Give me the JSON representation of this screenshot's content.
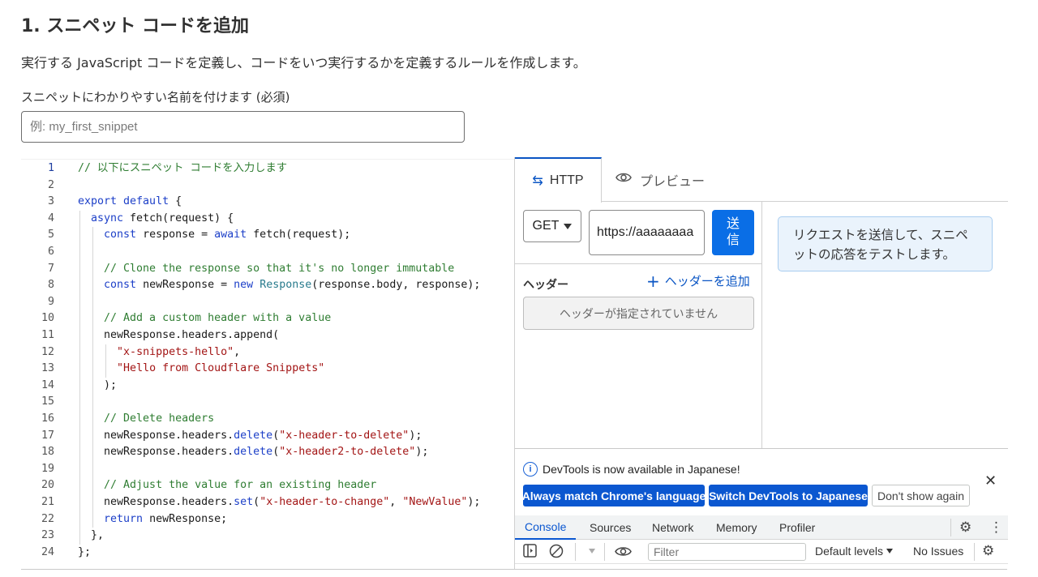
{
  "page": {
    "title": "1. スニペット コードを追加",
    "description": "実行する JavaScript コードを定義し、コードをいつ実行するかを定義するルールを作成します。",
    "name_label": "スニペットにわかりやすい名前を付けます (必須)",
    "name_placeholder": "例: my_first_snippet"
  },
  "editor": {
    "line_numbers": [
      "1",
      "2",
      "3",
      "4",
      "5",
      "6",
      "7",
      "8",
      "9",
      "10",
      "11",
      "12",
      "13",
      "14",
      "15",
      "16",
      "17",
      "18",
      "19",
      "20",
      "21",
      "22",
      "23",
      "24"
    ],
    "active_line": 1,
    "lines": [
      [
        {
          "t": "// 以下にスニペット コードを入力します",
          "c": "cm"
        }
      ],
      [],
      [
        {
          "t": "export default",
          "c": "kw"
        },
        {
          "t": " {",
          "c": ""
        }
      ],
      [
        {
          "t": "  ",
          "c": ""
        },
        {
          "t": "async",
          "c": "kw"
        },
        {
          "t": " fetch(request) {",
          "c": ""
        }
      ],
      [
        {
          "t": "    ",
          "c": ""
        },
        {
          "t": "const",
          "c": "kw"
        },
        {
          "t": " response = ",
          "c": ""
        },
        {
          "t": "await",
          "c": "kw"
        },
        {
          "t": " fetch(request);",
          "c": ""
        }
      ],
      [],
      [
        {
          "t": "    // Clone the response so that it's no longer immutable",
          "c": "cm"
        }
      ],
      [
        {
          "t": "    ",
          "c": ""
        },
        {
          "t": "const",
          "c": "kw"
        },
        {
          "t": " newResponse = ",
          "c": ""
        },
        {
          "t": "new",
          "c": "kw"
        },
        {
          "t": " ",
          "c": ""
        },
        {
          "t": "Response",
          "c": "type"
        },
        {
          "t": "(response.body, response);",
          "c": ""
        }
      ],
      [],
      [
        {
          "t": "    // Add a custom header with a value",
          "c": "cm"
        }
      ],
      [
        {
          "t": "    newResponse.headers.append(",
          "c": ""
        }
      ],
      [
        {
          "t": "      ",
          "c": ""
        },
        {
          "t": "\"x-snippets-hello\"",
          "c": "str"
        },
        {
          "t": ",",
          "c": ""
        }
      ],
      [
        {
          "t": "      ",
          "c": ""
        },
        {
          "t": "\"Hello from Cloudflare Snippets\"",
          "c": "str"
        }
      ],
      [
        {
          "t": "    );",
          "c": ""
        }
      ],
      [],
      [
        {
          "t": "    // Delete headers",
          "c": "cm"
        }
      ],
      [
        {
          "t": "    newResponse.headers.",
          "c": ""
        },
        {
          "t": "delete",
          "c": "kw"
        },
        {
          "t": "(",
          "c": ""
        },
        {
          "t": "\"x-header-to-delete\"",
          "c": "str"
        },
        {
          "t": ");",
          "c": ""
        }
      ],
      [
        {
          "t": "    newResponse.headers.",
          "c": ""
        },
        {
          "t": "delete",
          "c": "kw"
        },
        {
          "t": "(",
          "c": ""
        },
        {
          "t": "\"x-header2-to-delete\"",
          "c": "str"
        },
        {
          "t": ");",
          "c": ""
        }
      ],
      [],
      [
        {
          "t": "    // Adjust the value for an existing header",
          "c": "cm"
        }
      ],
      [
        {
          "t": "    newResponse.headers.",
          "c": ""
        },
        {
          "t": "set",
          "c": "kw"
        },
        {
          "t": "(",
          "c": ""
        },
        {
          "t": "\"x-header-to-change\"",
          "c": "str"
        },
        {
          "t": ", ",
          "c": ""
        },
        {
          "t": "\"NewValue\"",
          "c": "str"
        },
        {
          "t": ");",
          "c": ""
        }
      ],
      [
        {
          "t": "    ",
          "c": ""
        },
        {
          "t": "return",
          "c": "kw"
        },
        {
          "t": " newResponse;",
          "c": ""
        }
      ],
      [
        {
          "t": "  },",
          "c": ""
        }
      ],
      [
        {
          "t": "};",
          "c": ""
        }
      ]
    ]
  },
  "preview": {
    "tabs": [
      {
        "label": "HTTP",
        "icon": "swap-arrows-icon"
      },
      {
        "label": "プレビュー",
        "icon": "eye-icon"
      }
    ],
    "method": "GET",
    "url": "https://aaaaaaaa",
    "send_label_1": "送",
    "send_label_2": "信",
    "headers_label": "ヘッダー",
    "add_header_label": "ヘッダーを追加",
    "no_headers_text": "ヘッダーが指定されていません",
    "response_hint": "リクエストを送信して、スニペットの応答をテストします。"
  },
  "devtools": {
    "notice": "DevTools is now available in Japanese!",
    "btn_match": "Always match Chrome's language",
    "btn_switch": "Switch DevTools to Japanese",
    "btn_dont_show": "Don't show again",
    "tabs": [
      "Console",
      "Sources",
      "Network",
      "Memory",
      "Profiler"
    ],
    "filter_placeholder": "Filter",
    "levels_label": "Default levels",
    "issues_label": "No Issues"
  },
  "colors": {
    "accent": "#0a55c4",
    "send_button": "#0a6ee6",
    "devtools_primary": "#0b57d0",
    "comment": "#2f7d32",
    "keyword": "#1c3fc8",
    "string": "#a31515"
  }
}
